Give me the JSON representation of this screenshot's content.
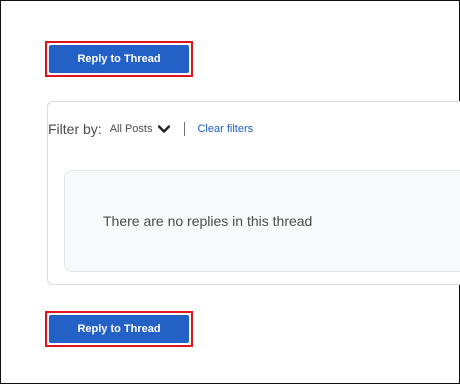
{
  "actions": {
    "reply_top_label": "Reply to Thread",
    "reply_bottom_label": "Reply to Thread"
  },
  "filter": {
    "label": "Filter by:",
    "selected_value": "All Posts",
    "clear_label": "Clear filters"
  },
  "replies": {
    "empty_message": "There are no replies in this thread"
  },
  "colors": {
    "button_bg": "#2461c6",
    "highlight_border": "#e0141e",
    "link": "#1d5fc9"
  },
  "icons": {
    "filter_dropdown": "chevron-down-icon"
  }
}
